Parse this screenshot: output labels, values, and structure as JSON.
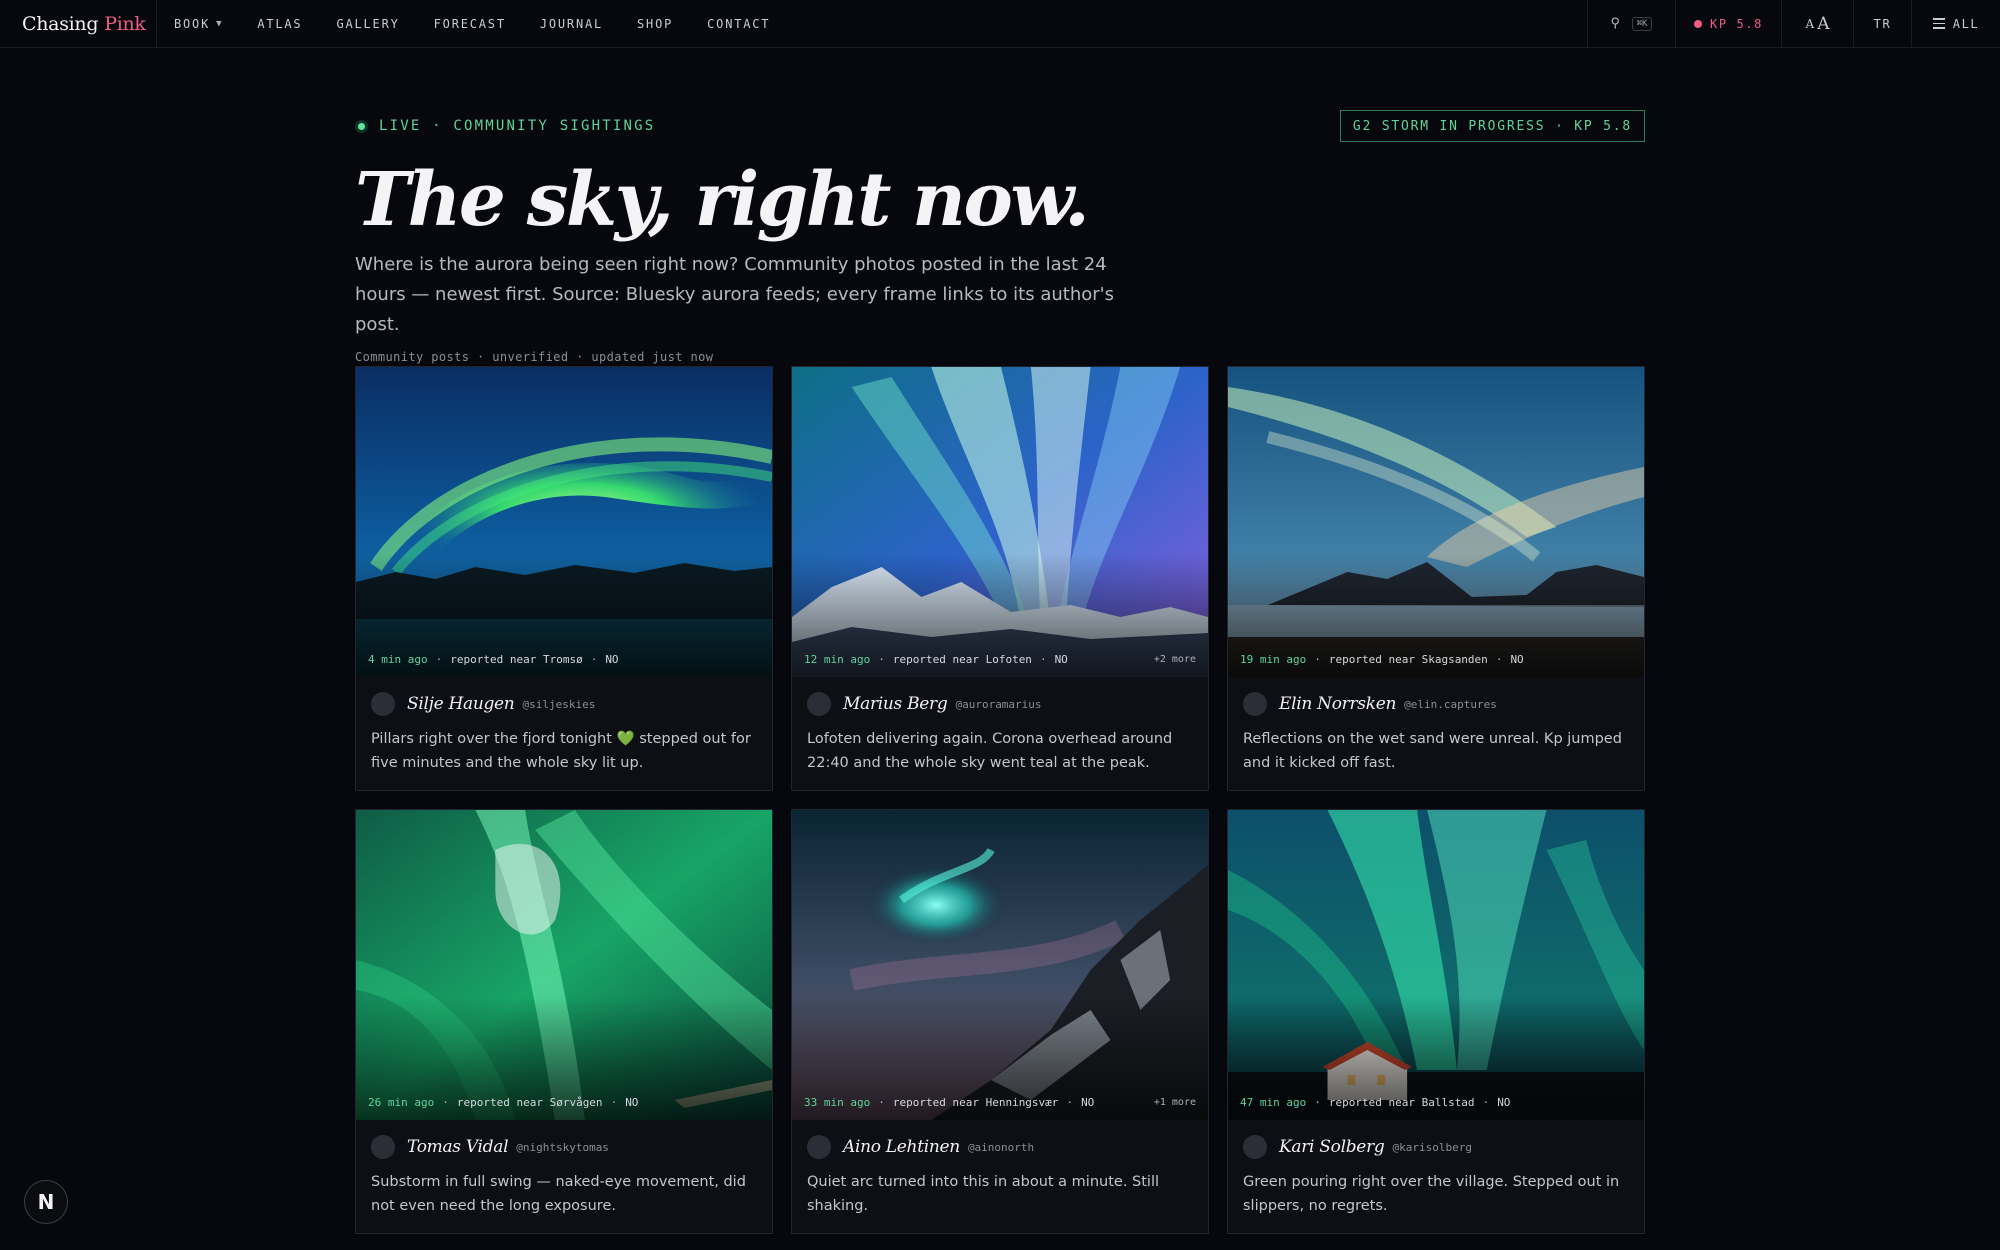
{
  "brand": {
    "part1": "Chasing",
    "part2": "Pink"
  },
  "nav": {
    "items": [
      {
        "label": "BOOK",
        "has_dropdown": true
      },
      {
        "label": "ATLAS"
      },
      {
        "label": "GALLERY"
      },
      {
        "label": "FORECAST"
      },
      {
        "label": "JOURNAL"
      },
      {
        "label": "SHOP"
      },
      {
        "label": "CONTACT"
      }
    ],
    "search_shortcut": "⌘K",
    "kp_badge": "KP 5.8",
    "text_size_label": "A",
    "text_size_label_large": "A",
    "language": "TR",
    "all_label": "ALL"
  },
  "hero": {
    "live_label": "LIVE · COMMUNITY SIGHTINGS",
    "storm_badge": "G2 STORM IN PROGRESS · KP 5.8",
    "headline": "The sky, right now.",
    "subtitle": "Where is the aurora being seen right now? Community photos posted in the last 24 hours — newest first. Source: Bluesky aurora feeds; every frame links to its author's post.",
    "meta": "Community posts · unverified · updated just now"
  },
  "colors": {
    "background": "#07080d",
    "accent_pink": "#ee5d83",
    "accent_green": "#5fd39a",
    "card_bg": "#0d0f15"
  },
  "posts": [
    {
      "ago": "4 min ago",
      "location": "reported near Tromsø",
      "country": "NO",
      "more": "",
      "author": "Silje Haugen",
      "handle": "@siljeskies",
      "text": "Pillars right over the fjord tonight 💚 stepped out for five minutes and the whole sky lit up."
    },
    {
      "ago": "12 min ago",
      "location": "reported near Lofoten",
      "country": "NO",
      "more": "+2 more",
      "author": "Marius Berg",
      "handle": "@auroramarius",
      "text": "Lofoten delivering again. Corona overhead around 22:40 and the whole sky went teal at the peak."
    },
    {
      "ago": "19 min ago",
      "location": "reported near Skagsanden",
      "country": "NO",
      "more": "",
      "author": "Elin Norrsken",
      "handle": "@elin.captures",
      "text": "Reflections on the wet sand were unreal. Kp jumped and it kicked off fast."
    },
    {
      "ago": "26 min ago",
      "location": "reported near Sørvågen",
      "country": "NO",
      "more": "",
      "author": "Tomas Vidal",
      "handle": "@nightskytomas",
      "text": "Substorm in full swing — naked-eye movement, did not even need the long exposure."
    },
    {
      "ago": "33 min ago",
      "location": "reported near Henningsvær",
      "country": "NO",
      "more": "+1 more",
      "author": "Aino Lehtinen",
      "handle": "@ainonorth",
      "text": "Quiet arc turned into this in about a minute. Still shaking."
    },
    {
      "ago": "47 min ago",
      "location": "reported near Ballstad",
      "country": "NO",
      "more": "",
      "author": "Kari Solberg",
      "handle": "@karisolberg",
      "text": "Green pouring right over the village. Stepped out in slippers, no regrets."
    }
  ],
  "fab_label": "N"
}
